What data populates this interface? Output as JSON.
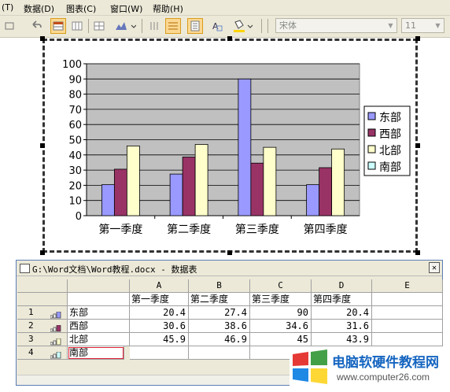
{
  "menu": {
    "items": [
      "(T)",
      "数据(D)",
      "图表(C)",
      "窗口(W)",
      "帮助(H)"
    ]
  },
  "toolbar": {
    "font_name": "宋体",
    "font_size": "11"
  },
  "chart_data": {
    "type": "bar",
    "categories": [
      "第一季度",
      "第二季度",
      "第三季度",
      "第四季度"
    ],
    "series": [
      {
        "name": "东部",
        "values": [
          20.4,
          27.4,
          90,
          20.4
        ],
        "color": "#9999ff"
      },
      {
        "name": "西部",
        "values": [
          30.6,
          38.6,
          34.6,
          31.6
        ],
        "color": "#993366"
      },
      {
        "name": "北部",
        "values": [
          45.9,
          46.9,
          45,
          43.9
        ],
        "color": "#ffffcc"
      },
      {
        "name": "南部",
        "values": [],
        "color": "#ccffff"
      }
    ],
    "ylim": [
      0,
      100
    ],
    "yticks": [
      "0",
      "10",
      "20",
      "30",
      "40",
      "50",
      "60",
      "70",
      "80",
      "90",
      "100"
    ],
    "plot_bg": "#c0c0c0",
    "grid": true,
    "legend": "right"
  },
  "datasheet": {
    "title": "G:\\Word文档\\Word教程.docx - 数据表",
    "columns": [
      "A",
      "B",
      "C",
      "D",
      "E"
    ],
    "header_row": [
      "",
      "第一季度",
      "第二季度",
      "第三季度",
      "第四季度",
      ""
    ],
    "rows": [
      {
        "num": "1",
        "label": "东部",
        "cells": [
          "20.4",
          "27.4",
          "90",
          "20.4",
          ""
        ],
        "swatch": "#9999ff"
      },
      {
        "num": "2",
        "label": "西部",
        "cells": [
          "30.6",
          "38.6",
          "34.6",
          "31.6",
          ""
        ],
        "swatch": "#993366"
      },
      {
        "num": "3",
        "label": "北部",
        "cells": [
          "45.9",
          "46.9",
          "45",
          "43.9",
          ""
        ],
        "swatch": "#ffffcc"
      },
      {
        "num": "4",
        "label": "南部",
        "cells": [
          "",
          "",
          "",
          "",
          ""
        ],
        "swatch": "#ccffff"
      }
    ]
  },
  "watermark": {
    "name": "电脑软硬件教程网",
    "url": "www.computer26.com",
    "colors": {
      "red": "#e53935",
      "green": "#43a047",
      "blue": "#1e88e5",
      "yellow": "#fdd835"
    }
  }
}
